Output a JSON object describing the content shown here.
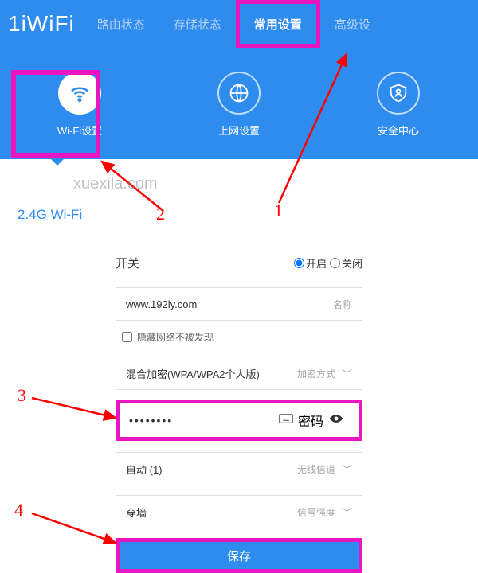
{
  "logo": "1iWiFi",
  "nav": {
    "items": [
      "路由状态",
      "存储状态",
      "常用设置",
      "高级设"
    ]
  },
  "iconTabs": {
    "items": [
      {
        "label": "Wi-Fi设置"
      },
      {
        "label": "上网设置"
      },
      {
        "label": "安全中心"
      }
    ]
  },
  "section": {
    "title": "2.4G Wi-Fi"
  },
  "form": {
    "switchLabel": "开关",
    "radioOn": "开启",
    "radioOff": "关闭",
    "ssidValue": "www.192ly.com",
    "ssidHint": "名称",
    "hideSsid": "隐藏网络不被发现",
    "encryptValue": "混合加密(WPA/WPA2个人版)",
    "encryptHint": "加密方式",
    "passwordDots": "••••••••",
    "passwordHint": "密码",
    "channelValue": "自动 (1)",
    "channelHint": "无线信道",
    "signalValue": "穿墙",
    "signalHint": "信号强度",
    "saveLabel": "保存"
  },
  "annotations": {
    "n1": "1",
    "n2": "2",
    "n3": "3",
    "n4": "4"
  },
  "watermark": "xuexila.com"
}
